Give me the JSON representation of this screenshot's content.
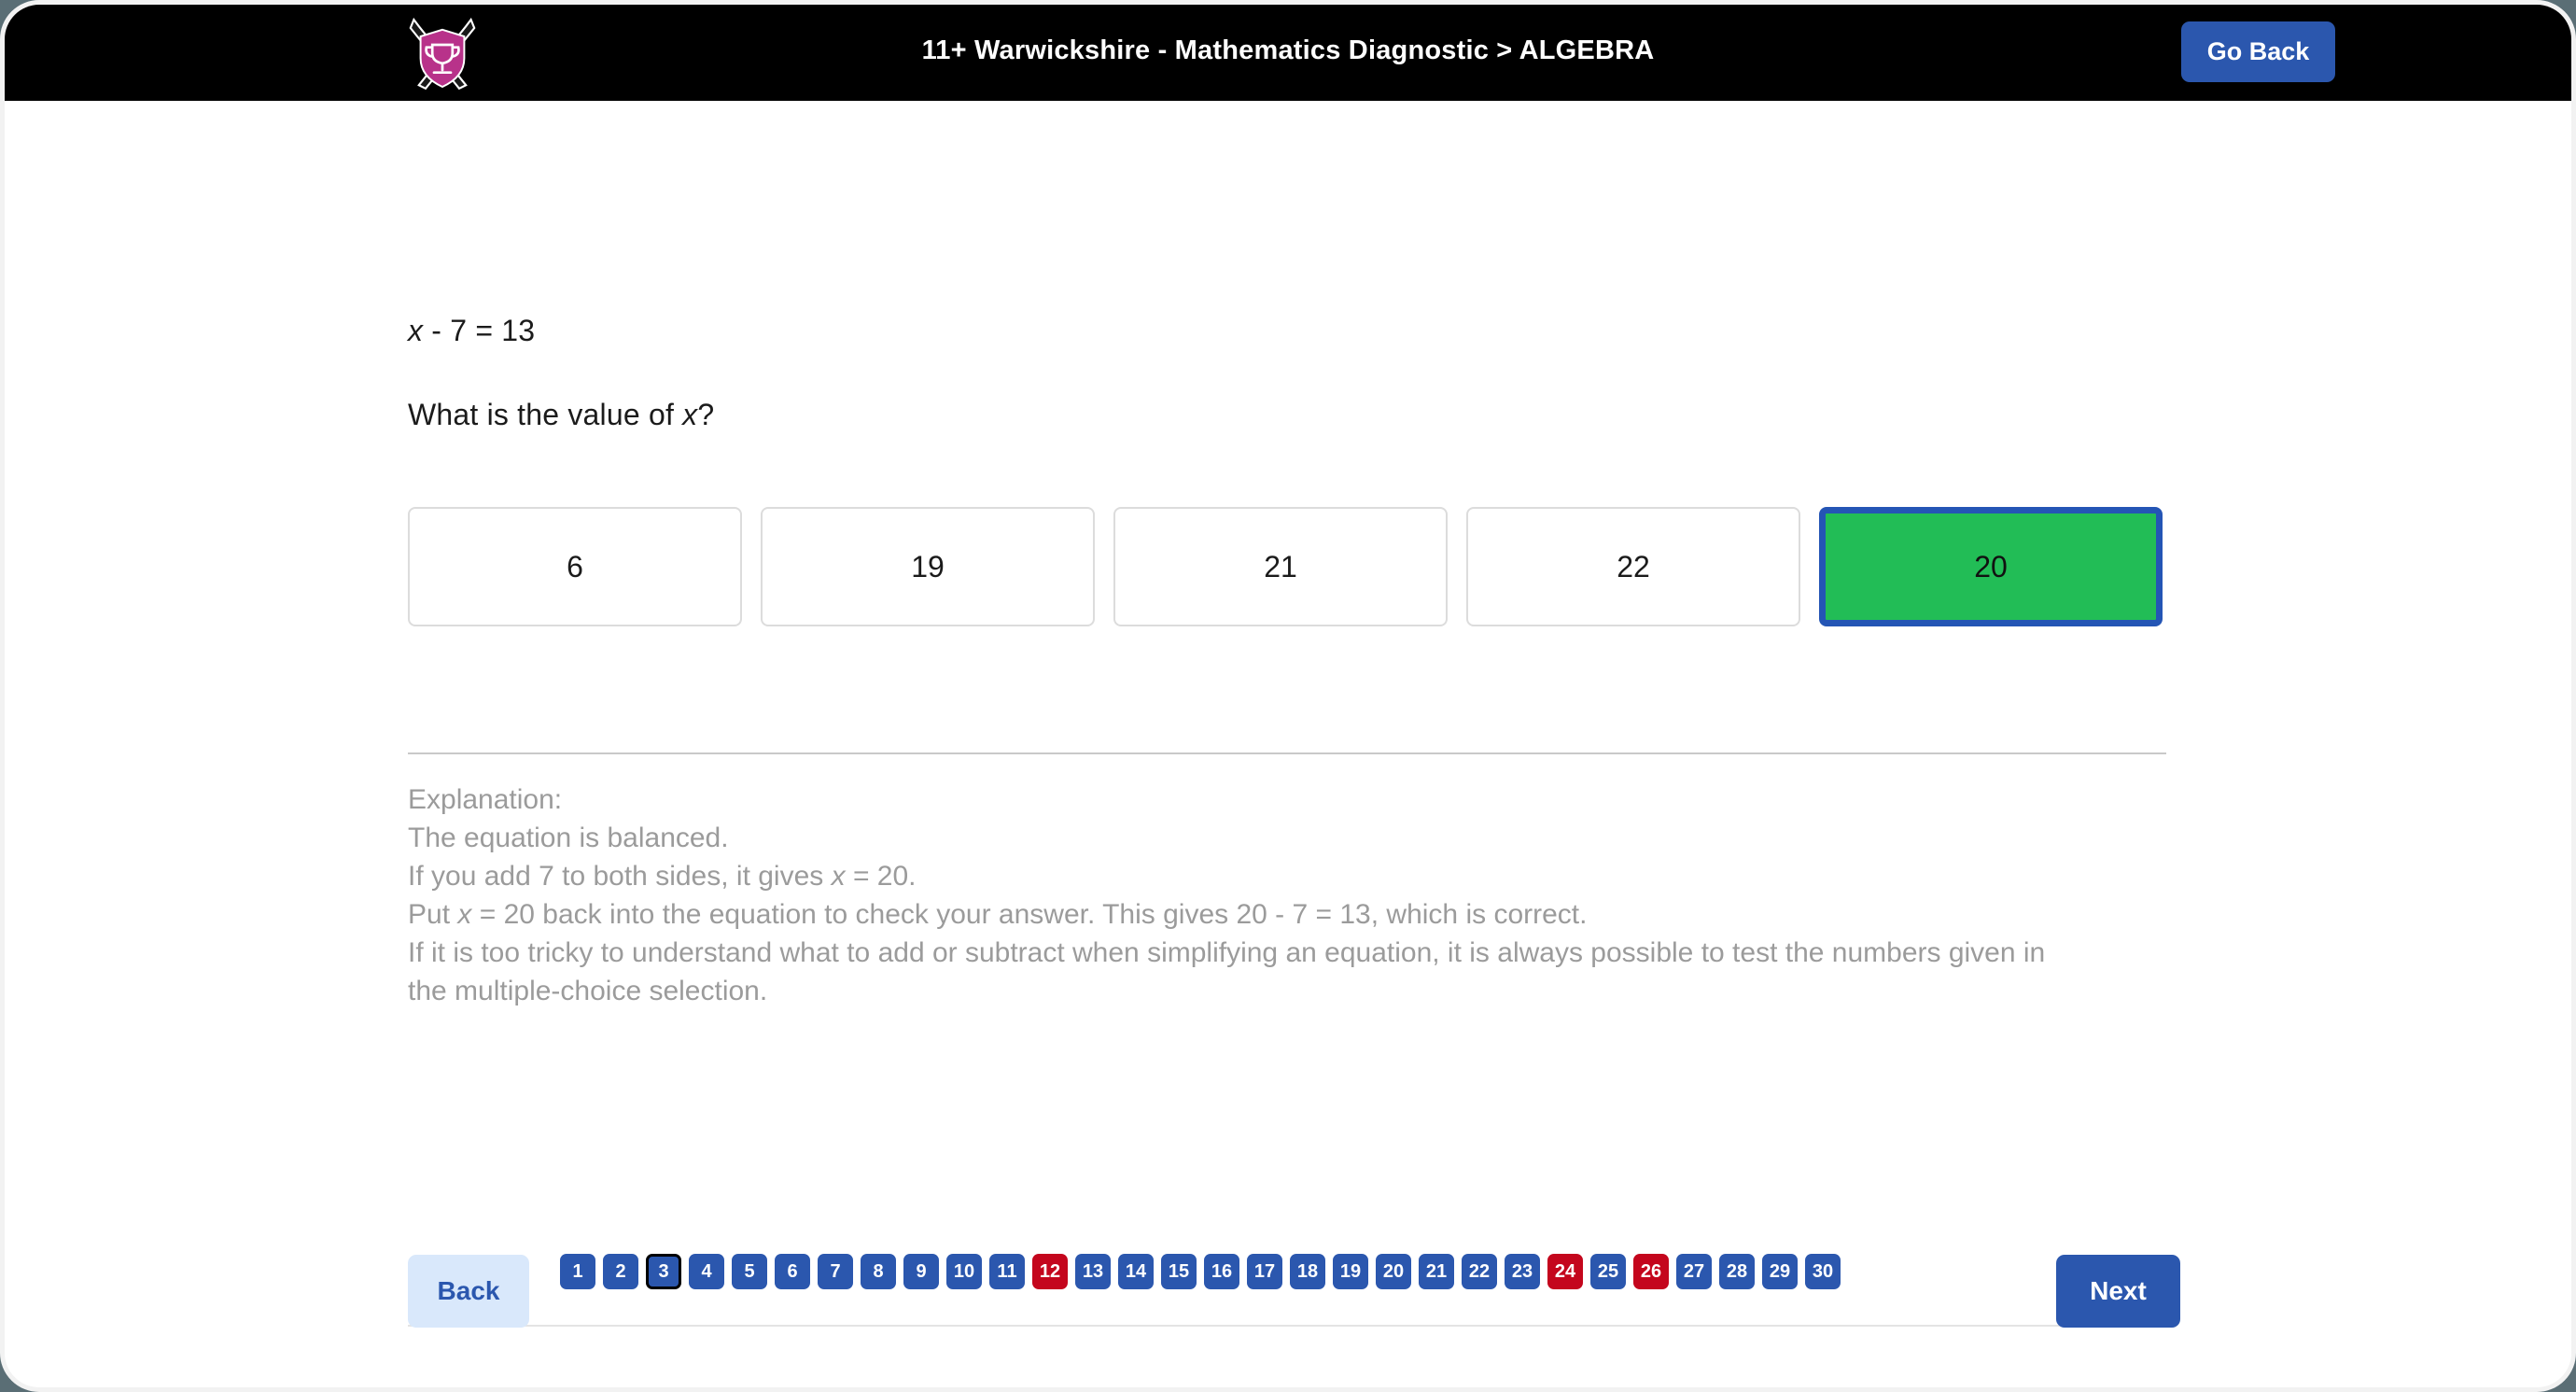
{
  "header": {
    "logo_icon": "shield-trophy-crossed-pencils-logo",
    "title": "11+ Warwickshire - Mathematics Diagnostic > ALGEBRA",
    "go_back_label": "Go Back",
    "accent_blue": "#2b57ae",
    "background": "#000000",
    "logo_color": "#b8328a"
  },
  "question": {
    "equation_prefix": "x",
    "equation_rest": " - 7 = 13",
    "prompt_prefix": "What is the value of ",
    "prompt_var": "x",
    "prompt_suffix": "?",
    "options": [
      {
        "label": "6",
        "state": "default"
      },
      {
        "label": "19",
        "state": "default"
      },
      {
        "label": "21",
        "state": "default"
      },
      {
        "label": "22",
        "state": "default"
      },
      {
        "label": "20",
        "state": "selected-correct"
      }
    ],
    "correct_color": "#22bd56",
    "selected_border_color": "#2455b5"
  },
  "explanation": {
    "heading": "Explanation:",
    "line1": "The equation is balanced.",
    "line2_a": "If you add 7 to both sides, it gives ",
    "line2_var": "x",
    "line2_b": " = 20.",
    "line3_a": "Put ",
    "line3_var": "x",
    "line3_b": " = 20 back into the equation to check your answer. This gives 20 - 7 = 13, which is correct.",
    "line4": "If it is too tricky to understand what to add or subtract when simplifying an equation, it is always possible to test the numbers given in the multiple-choice selection.",
    "text_color": "#9b9b9b"
  },
  "footer": {
    "back_label": "Back",
    "next_label": "Next",
    "back_bg": "#d9e8fb",
    "next_bg": "#2b57ae",
    "flag_color": "#c4061d",
    "current_page": 3,
    "pages": [
      {
        "n": "1",
        "state": "default"
      },
      {
        "n": "2",
        "state": "default"
      },
      {
        "n": "3",
        "state": "current"
      },
      {
        "n": "4",
        "state": "default"
      },
      {
        "n": "5",
        "state": "default"
      },
      {
        "n": "6",
        "state": "default"
      },
      {
        "n": "7",
        "state": "default"
      },
      {
        "n": "8",
        "state": "default"
      },
      {
        "n": "9",
        "state": "default"
      },
      {
        "n": "10",
        "state": "default"
      },
      {
        "n": "11",
        "state": "default"
      },
      {
        "n": "12",
        "state": "flagged"
      },
      {
        "n": "13",
        "state": "default"
      },
      {
        "n": "14",
        "state": "default"
      },
      {
        "n": "15",
        "state": "default"
      },
      {
        "n": "16",
        "state": "default"
      },
      {
        "n": "17",
        "state": "default"
      },
      {
        "n": "18",
        "state": "default"
      },
      {
        "n": "19",
        "state": "default"
      },
      {
        "n": "20",
        "state": "default"
      },
      {
        "n": "21",
        "state": "default"
      },
      {
        "n": "22",
        "state": "default"
      },
      {
        "n": "23",
        "state": "default"
      },
      {
        "n": "24",
        "state": "flagged"
      },
      {
        "n": "25",
        "state": "default"
      },
      {
        "n": "26",
        "state": "flagged"
      },
      {
        "n": "27",
        "state": "default"
      },
      {
        "n": "28",
        "state": "default"
      },
      {
        "n": "29",
        "state": "default"
      },
      {
        "n": "30",
        "state": "default"
      }
    ]
  }
}
